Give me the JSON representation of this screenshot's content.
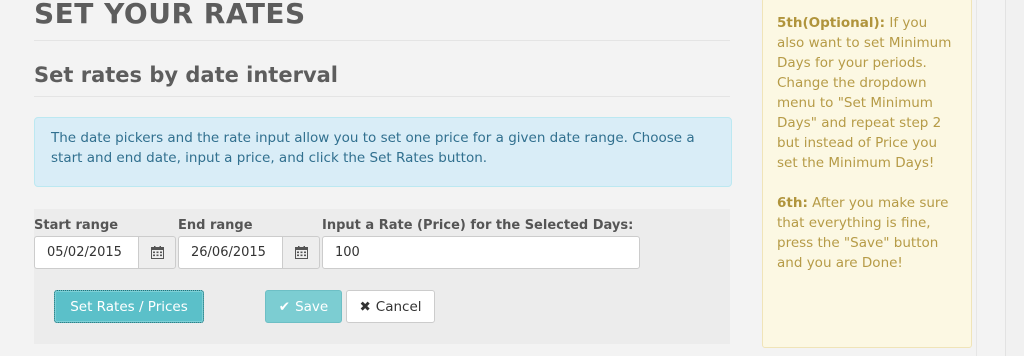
{
  "page": {
    "title": "SET YOUR RATES",
    "section_title": "Set rates by date interval"
  },
  "info": {
    "text": "The date pickers and the rate input allow you to set one price for a given date range. Choose a start and end date, input a price, and click the Set Rates button."
  },
  "form": {
    "start_label": "Start range",
    "start_value": "05/02/2015",
    "end_label": "End range",
    "end_value": "26/06/2015",
    "rate_label": "Input a Rate (Price) for the Selected Days:",
    "rate_value": "100",
    "calendar_icon": "calendar-icon"
  },
  "buttons": {
    "set_rates": "Set Rates / Prices",
    "save": "Save",
    "save_icon": "check-icon",
    "cancel": "Cancel",
    "cancel_icon": "times-icon"
  },
  "help": {
    "step5_heading": "5th(Optional):",
    "step5_text": " If you also want to set Minimum Days for your periods. Change the dropdown menu to \"Set Minimum Days\" and repeat step 2 but instead of Price you set the Minimum Days!",
    "step6_heading": "6th:",
    "step6_text": " After you make sure that everything is fine, press the \"Save\" button and you are Done!"
  },
  "colors": {
    "info_bg": "#d9edf7",
    "info_text": "#31708f",
    "help_bg": "#fcf8e3",
    "help_text": "#b69b47",
    "primary_button": "#5bc0c9"
  }
}
